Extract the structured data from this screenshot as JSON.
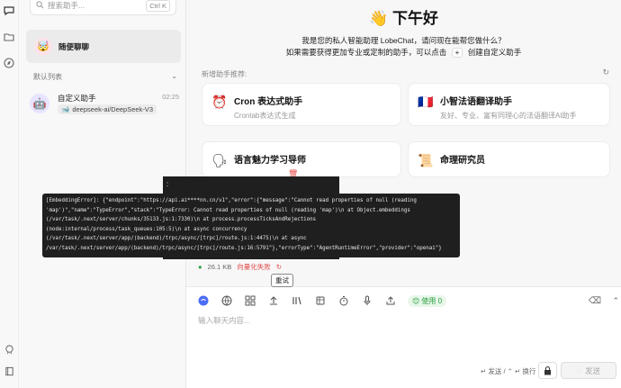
{
  "sidebar": {
    "search": {
      "placeholder": "搜索助手...",
      "shortcut": "Ctrl K"
    },
    "random_chat": {
      "label": "随便聊聊"
    },
    "section": {
      "title": "默认列表"
    },
    "agents": [
      {
        "title": "自定义助手",
        "time": "02:25",
        "model": "deepseek-ai/DeepSeek-V3"
      }
    ]
  },
  "main": {
    "greeting": "下午好",
    "intro_line1": "我是您的私人智能助理 LobeChat，请问现在能帮您做什么？",
    "intro_line2_before": "如果需要获得更加专业或定制的助手，可以点击",
    "intro_line2_after": "创建自定义助手",
    "plus_chip": "+",
    "recommend_title": "新增助手推荐:",
    "cards": [
      {
        "icon": "⏰",
        "title": "Cron 表达式助手",
        "desc": "Crontab表达式生成"
      },
      {
        "icon": "🇫🇷",
        "title": "小智法语翻译助手",
        "desc": "友好、专业、富有同理心的法语翻译AI助手"
      },
      {
        "icon": "🗣",
        "title": "语言魅力学习导师",
        "desc": ""
      },
      {
        "icon": "📜",
        "title": "命理研究员",
        "desc": ""
      }
    ]
  },
  "error": {
    "colon": ":",
    "text": "[EmbeddingError]: {\"endpoint\":\"https://api.ai****nn.cn/v1\",\"error\":{\"message\":\"Cannot read properties of null (reading\n'map')\",\"name\":\"TypeError\",\"stack\":\"TypeError: Cannot read properties of null (reading 'map')\\n at Object.embeddings\n(/var/task/.next/server/chunks/35133.js:1:7330)\\n at process.processTicksAndRejections\n(node:internal/process/task_queues:105:5)\\n at async concurrency\n(/var/task/.next/server/app/(backend)/trpc/async/[trpc]/route.js:1:4475)\\n at async\n/var/task/.next/server/app/(backend)/trpc/async/[trpc]/route.js:16:5791\"},\"errorType\":\"AgentRuntimeError\",\"provider\":\"openai\"}",
    "file_size": "26.1 KB",
    "vector_failed": "向量化失败",
    "retry_tooltip": "重试"
  },
  "input": {
    "placeholder": "输入聊天内容...",
    "usage_label": "使用 0",
    "send_hint": "↵ 发送 / ⌃ ↵ 换行",
    "send_button": "发送"
  }
}
